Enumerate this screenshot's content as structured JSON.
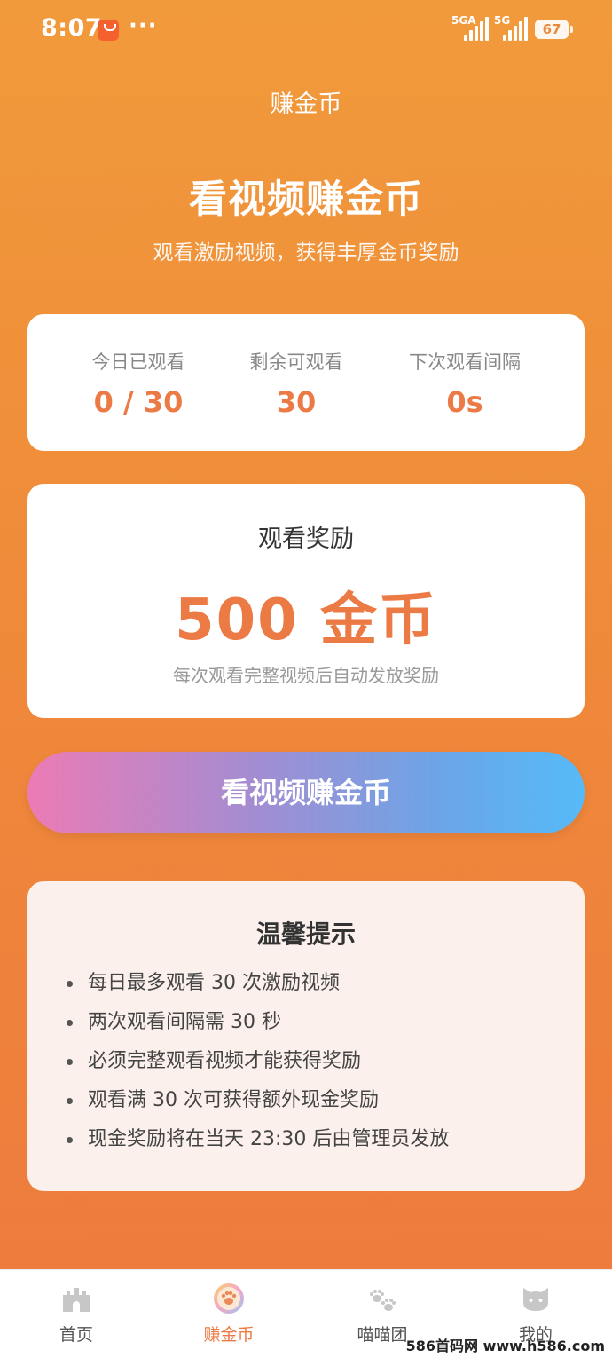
{
  "status_bar": {
    "time": "8:07",
    "dots": "···",
    "signal1_label": "5GA",
    "signal2_label": "5G",
    "battery": "67"
  },
  "page_title": "赚金币",
  "hero": {
    "title": "看视频赚金币",
    "subtitle": "观看激励视频，获得丰厚金币奖励"
  },
  "stats": [
    {
      "label": "今日已观看",
      "value": "0 / 30"
    },
    {
      "label": "剩余可观看",
      "value": "30"
    },
    {
      "label": "下次观看间隔",
      "value": "0s"
    }
  ],
  "reward": {
    "title": "观看奖励",
    "amount": "500 金币",
    "note": "每次观看完整视频后自动发放奖励"
  },
  "cta_label": "看视频赚金币",
  "tips": {
    "title": "温馨提示",
    "items": [
      "每日最多观看 30 次激励视频",
      "两次观看间隔需 30 秒",
      "必须完整观看视频才能获得奖励",
      "观看满 30 次可获得额外现金奖励",
      "现金奖励将在当天 23:30 后由管理员发放"
    ]
  },
  "tabbar": {
    "items": [
      {
        "label": "首页",
        "icon": "castle-icon"
      },
      {
        "label": "赚金币",
        "icon": "paw-coin-icon",
        "active": true
      },
      {
        "label": "喵喵团",
        "icon": "paw-prints-icon"
      },
      {
        "label": "我的",
        "icon": "cat-face-icon"
      }
    ]
  },
  "watermark": "586首码网 www.h586.com",
  "colors": {
    "background_top": "#F19A3B",
    "background_bottom": "#EE7A3E",
    "accent": "#EC7A45",
    "cta_gradient_start": "#EC7BB5",
    "cta_gradient_end": "#56BAF8",
    "tips_background": "#FBF0EB"
  }
}
